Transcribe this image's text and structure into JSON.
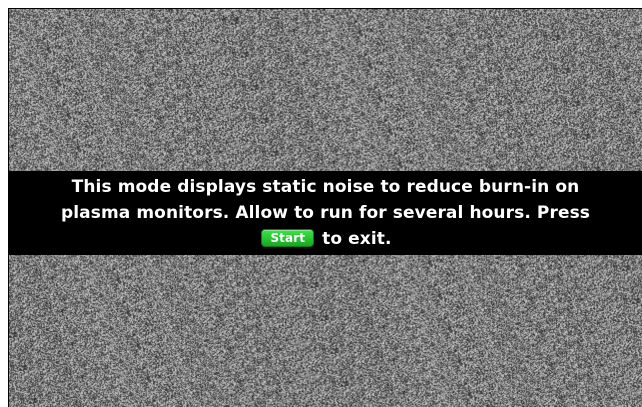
{
  "message": {
    "line1": "This mode displays static noise to reduce burn-in on plasma monitors. Allow to run for several hours. Press",
    "start_label": "Start",
    "line_end": "to exit."
  },
  "colors": {
    "band": "#000000",
    "text": "#ffffff",
    "start_button": "#22c02c"
  }
}
